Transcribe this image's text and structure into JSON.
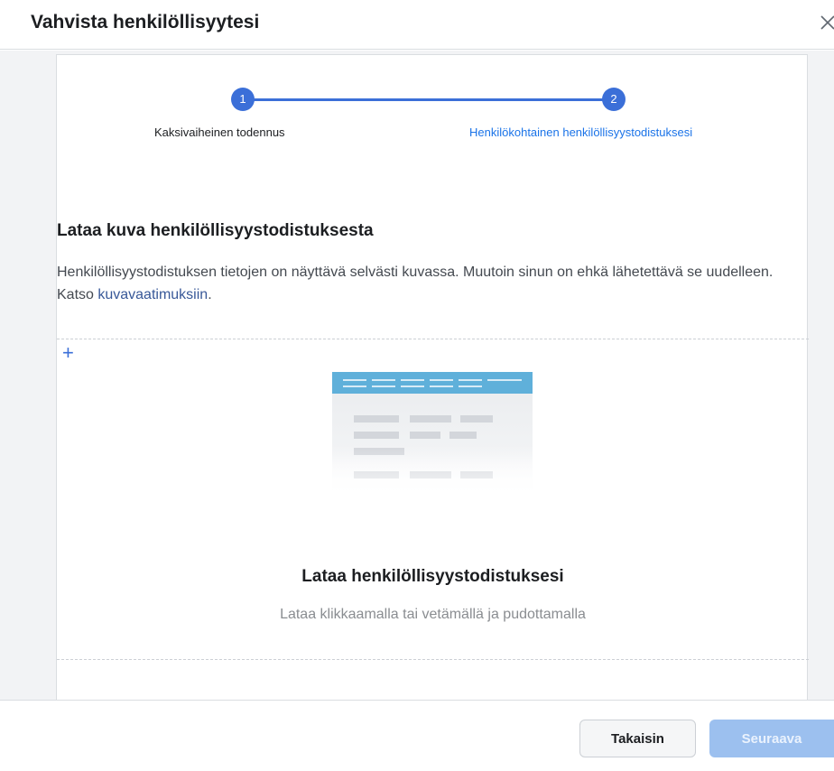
{
  "dialog": {
    "title": "Vahvista henkilöllisyytesi",
    "close_icon": "close-icon"
  },
  "stepper": {
    "steps": [
      {
        "number": "1",
        "label": "Kaksivaiheinen todennus",
        "state": "completed"
      },
      {
        "number": "2",
        "label": "Henkilökohtainen henkilöllisyystodistuksesi",
        "state": "active"
      }
    ],
    "accent_color": "#3b6fd8"
  },
  "section": {
    "title": "Lataa kuva henkilöllisyystodistuksesta",
    "description_prefix": "Henkilöllisyystodistuksen tietojen on näyttävä selvästi kuvassa. Muutoin sinun on ehkä lähetettävä se uudelleen. Katso ",
    "description_link": "kuvavaatimuksiin",
    "description_suffix": "."
  },
  "upload": {
    "plus_icon": "+",
    "title": "Lataa henkilöllisyystodistuksesi",
    "subtitle": "Lataa klikkaamalla tai vetämällä ja pudottamalla"
  },
  "footer": {
    "back_label": "Takaisin",
    "next_label": "Seuraava"
  }
}
